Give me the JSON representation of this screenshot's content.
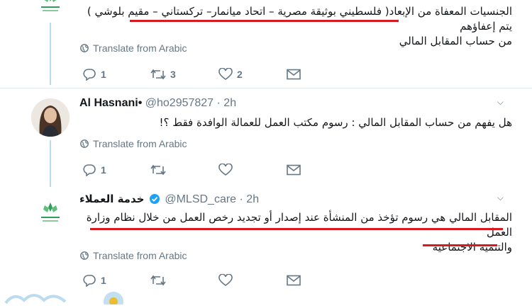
{
  "translate_label": "Translate from Arabic",
  "colors": {
    "accent": "#1da1f2",
    "underline": "#d71920",
    "thread": "#b9dcef",
    "muted": "#657786"
  },
  "tweets": [
    {
      "avatar": "ministry-logo",
      "body": [
        "الجنسيات المعفاة من الإبعاد( فلسطيني بوثيقة مصرية – اتحاد ميانمار– تركستاني – مقيم بلوشي ) يتم إعفاؤهم",
        "من حساب المقابل المالي"
      ],
      "stats": {
        "replies": "1",
        "retweets": "3",
        "likes": "2"
      }
    },
    {
      "avatar": "user-photo",
      "name": "Al Hasnani",
      "name_suffix": "•",
      "handle": "@ho2957827",
      "time": "· 2h",
      "body": [
        "هل يفهم من حساب المقابل المالي : رسوم مكتب العمل للعمالة الوافدة فقط ؟!"
      ],
      "stats": {
        "replies": "1",
        "retweets": "",
        "likes": ""
      }
    },
    {
      "avatar": "ministry-logo",
      "name": "خدمة العملاء",
      "handle": "@MLSD_care",
      "time": "· 2h",
      "body": [
        "المقابل المالي هي رسوم تؤخذ من المنشأة عند إصدار أو تجديد رخص العمل من خلال نظام وزارة العمل",
        "والتنمية الاجتماعية"
      ],
      "stats": {
        "replies": "1",
        "retweets": "",
        "likes": ""
      }
    }
  ]
}
